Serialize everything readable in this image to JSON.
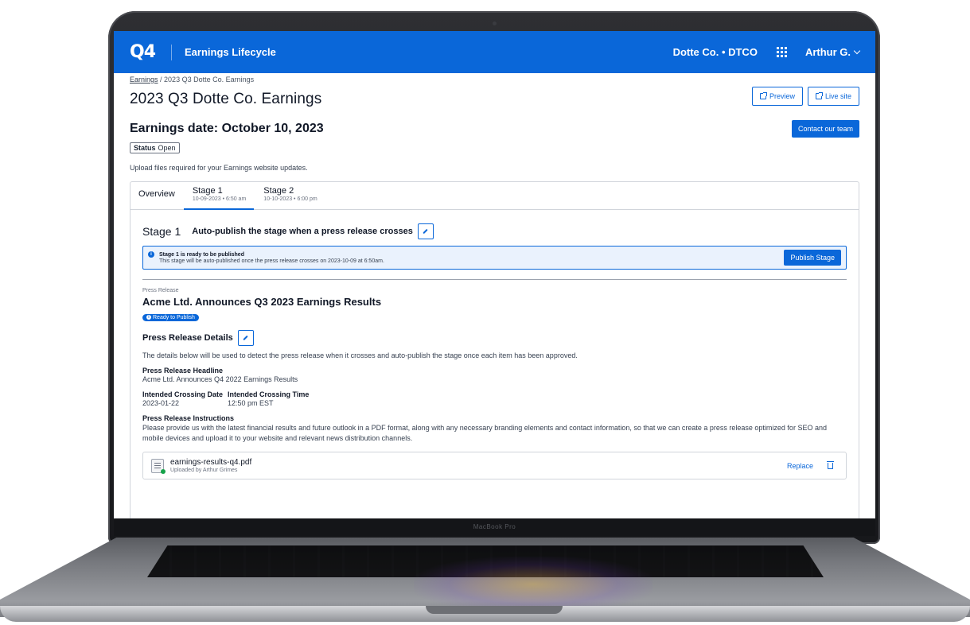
{
  "device": {
    "model_label": "MacBook Pro"
  },
  "header": {
    "logo": "Q4",
    "app_title": "Earnings Lifecycle",
    "company": "Dotte Co. • DTCO",
    "user": "Arthur G."
  },
  "breadcrumb": {
    "root": "Earnings",
    "separator": " / ",
    "current": "2023 Q3 Dotte Co. Earnings"
  },
  "page": {
    "title": "2023 Q3 Dotte Co. Earnings",
    "earnings_date": "Earnings date: October 10, 2023",
    "status_label": "Status",
    "status_value": "Open",
    "upload_note": "Upload files required for your Earnings website updates.",
    "preview_label": "Preview",
    "live_site_label": "Live site",
    "contact_label": "Contact our team"
  },
  "tabs": [
    {
      "label": "Overview",
      "sub": ""
    },
    {
      "label": "Stage 1",
      "sub": "10-09-2023 • 6:50 am"
    },
    {
      "label": "Stage 2",
      "sub": "10-10-2023 • 6:00 pm"
    }
  ],
  "stage": {
    "name": "Stage 1",
    "description": "Auto-publish the stage when a press release crosses",
    "alert_title": "Stage 1 is ready to be published",
    "alert_text": "This stage will be auto-published once the press release crosses on 2023-10-09 at 6:50am.",
    "publish_label": "Publish Stage"
  },
  "press_release": {
    "section_label": "Press Release",
    "title": "Acme Ltd. Announces Q3 2023 Earnings Results",
    "badge": "Ready to Publish",
    "details_title": "Press Release Details",
    "details_desc": "The details below will be used to detect the press release when it crosses and auto-publish the stage once each item has been approved.",
    "headline_label": "Press Release Headline",
    "headline_value": "Acme Ltd. Announces Q4 2022 Earnings Results",
    "date_label": "Intended Crossing Date",
    "date_value": "2023-01-22",
    "time_label": "Intended Crossing Time",
    "time_value": "12:50 pm EST",
    "instructions_label": "Press Release Instructions",
    "instructions_value": "Please provide us with the latest financial results and future outlook in a PDF format, along with any necessary branding elements and contact information, so that we can create a press release optimized for SEO and mobile devices and upload it to your website and relevant news distribution channels."
  },
  "file": {
    "name": "earnings-results-q4.pdf",
    "uploaded_by": "Uploaded by Arthur Grimes",
    "replace_label": "Replace"
  },
  "colors": {
    "brand": "#0a67d9",
    "alert_bg": "#eaf2fd"
  }
}
